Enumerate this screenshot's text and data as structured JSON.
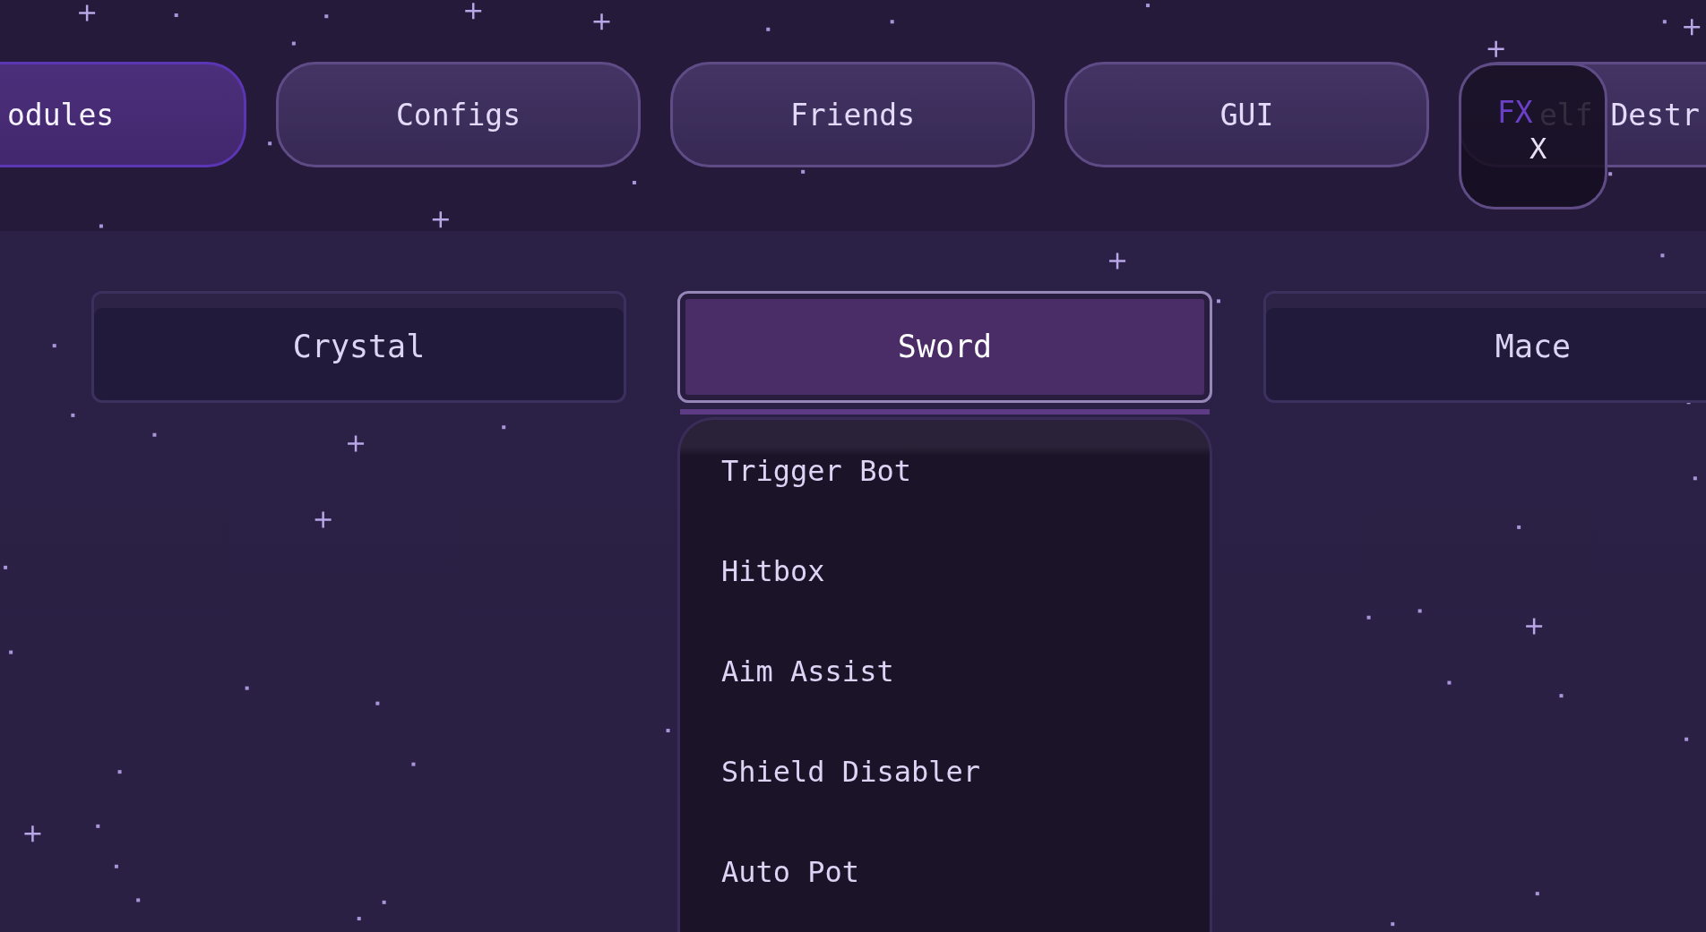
{
  "nav_tabs": [
    {
      "label": "odules",
      "selected": true
    },
    {
      "label": "Configs",
      "selected": false
    },
    {
      "label": "Friends",
      "selected": false
    },
    {
      "label": "GUI",
      "selected": false
    },
    {
      "label": "elf Destr",
      "selected": false
    }
  ],
  "fx_button": {
    "label": "FX",
    "sublabel": "X"
  },
  "categories": [
    {
      "label": "Crystal",
      "selected": false
    },
    {
      "label": "Sword",
      "selected": true
    },
    {
      "label": "Mace",
      "selected": false
    }
  ],
  "module_list": [
    "Trigger Bot",
    "Hitbox",
    "Aim Assist",
    "Shield Disabler",
    "Auto Pot"
  ]
}
